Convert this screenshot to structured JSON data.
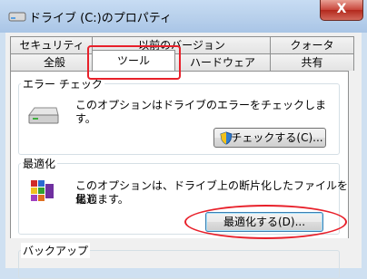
{
  "window": {
    "title": "ドライブ (C:)のプロパティ",
    "close_label": "X"
  },
  "tabs_row1": [
    "セキュリティ",
    "以前のバージョン",
    "クォータ"
  ],
  "tabs_row2": [
    "全般",
    "ツール",
    "ハードウェア",
    "共有"
  ],
  "active_tab": "ツール",
  "error_check": {
    "title": "エラー チェック",
    "description_line1": "このオプションはドライブのエラーをチェックしま",
    "description_line2": "す。",
    "button_label": "チェックする(C)..."
  },
  "defrag": {
    "title": "最適化",
    "description_line1": "このオプションは、ドライブ上の断片化したファイルを最適",
    "description_line2": "化します。",
    "button_label": "最適化する(D)..."
  },
  "backup": {
    "title": "バックアップ"
  },
  "icons": [
    "drive-icon",
    "hard-disk-icon",
    "shield-icon",
    "defrag-icon"
  ],
  "colors": {
    "annotation": "#e8202a",
    "title_bar": "#b9d1ec",
    "close_button": "#c7453a"
  }
}
